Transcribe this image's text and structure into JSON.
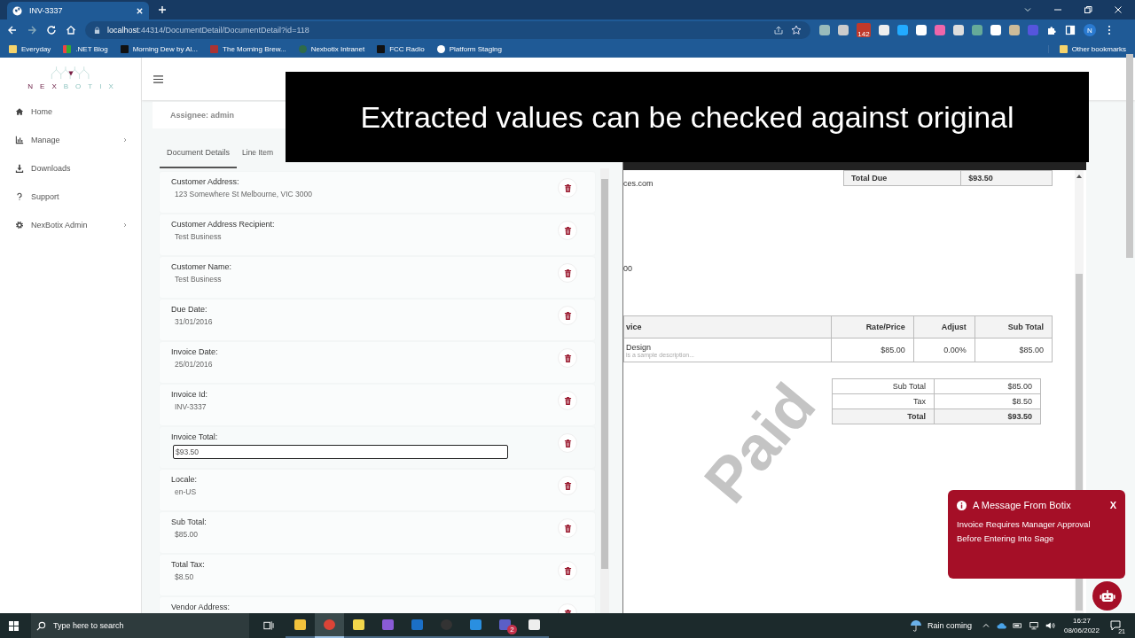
{
  "browser": {
    "tab_title": "INV-3337",
    "url_host": "localhost",
    "url_path": ":44314/DocumentDetail/DocumentDetail?id=118",
    "mail_badge": "142",
    "profile_initial": "N",
    "bookmarks": [
      {
        "kind": "folder",
        "label": "Everyday"
      },
      {
        "kind": "tiles",
        "label": ".NET Blog"
      },
      {
        "kind": "dark",
        "label": "Morning Dew by Al..."
      },
      {
        "kind": "cup",
        "label": "The Morning Brew..."
      },
      {
        "kind": "coin",
        "label": "Nexbotix Intranet"
      },
      {
        "kind": "dark",
        "label": "FCC Radio"
      },
      {
        "kind": "globe",
        "label": "Platform Staging"
      }
    ],
    "other_bookmarks": "Other bookmarks"
  },
  "sidebar": {
    "logo_parts": [
      "NEX",
      "BOTIX"
    ],
    "items": [
      {
        "kind": "home",
        "label": "Home",
        "has_submenu": false
      },
      {
        "kind": "chart",
        "label": "Manage",
        "has_submenu": true
      },
      {
        "kind": "download",
        "label": "Downloads",
        "has_submenu": false
      },
      {
        "kind": "help",
        "label": "Support",
        "has_submenu": false
      },
      {
        "kind": "gear",
        "label": "NexBotix Admin",
        "has_submenu": true
      }
    ]
  },
  "assignee": "Assignee: admin",
  "tabs": [
    {
      "label": "Document Details",
      "selected": true
    },
    {
      "label": "Line Item",
      "selected": false
    }
  ],
  "fields": [
    {
      "label": "Customer Address:",
      "value": "123 Somewhere St Melbourne, VIC 3000",
      "editing": false
    },
    {
      "label": "Customer Address Recipient:",
      "value": "Test Business",
      "editing": false
    },
    {
      "label": "Customer Name:",
      "value": "Test Business",
      "editing": false
    },
    {
      "label": "Due Date:",
      "value": "31/01/2016",
      "editing": false
    },
    {
      "label": "Invoice Date:",
      "value": "25/01/2016",
      "editing": false
    },
    {
      "label": "Invoice Id:",
      "value": "INV-3337",
      "editing": false
    },
    {
      "label": "Invoice Total:",
      "value": "$93.50",
      "editing": true
    },
    {
      "label": "Locale:",
      "value": "en-US",
      "editing": false
    },
    {
      "label": "Sub Total:",
      "value": "$85.00",
      "editing": false
    },
    {
      "label": "Total Tax:",
      "value": "$8.50",
      "editing": false
    },
    {
      "label": "Vendor Address:",
      "editing": false
    }
  ],
  "document": {
    "total_due_label": "Total Due",
    "total_due": "$93.50",
    "partial_email": "ces.com",
    "partial_number": "00",
    "stamp": "Paid",
    "columns": [
      "vice",
      "Rate/Price",
      "Adjust",
      "Sub Total"
    ],
    "rows": [
      {
        "item": "Design",
        "description": "is a sample description...",
        "rate": "$85.00",
        "adjust": "0.00%",
        "sub_total": "$85.00"
      }
    ],
    "totals": [
      {
        "label": "Sub Total",
        "value": "$85.00",
        "emphasis": false
      },
      {
        "label": "Tax",
        "value": "$8.50",
        "emphasis": false
      },
      {
        "label": "Total",
        "value": "$93.50",
        "emphasis": true
      }
    ]
  },
  "caption": "Extracted values can be checked against original",
  "message": {
    "title": "A Message From Botix",
    "close": "X",
    "body": "Invoice Requires Manager Approval Before Entering Into Sage"
  },
  "taskbar": {
    "search_placeholder": "Type here to search",
    "apps": [
      {
        "kind": "folder",
        "active": false
      },
      {
        "kind": "browser",
        "active": true
      },
      {
        "kind": "notes",
        "active": false
      },
      {
        "kind": "studio",
        "active": false
      },
      {
        "kind": "mail",
        "active": false
      },
      {
        "kind": "obs",
        "active": false
      },
      {
        "kind": "code",
        "active": false
      },
      {
        "kind": "teams",
        "active": false,
        "badge": "2"
      },
      {
        "kind": "app",
        "active": false
      }
    ],
    "weather": "Rain coming",
    "time": "16:27",
    "date": "08/06/2022",
    "notifications": "21"
  }
}
